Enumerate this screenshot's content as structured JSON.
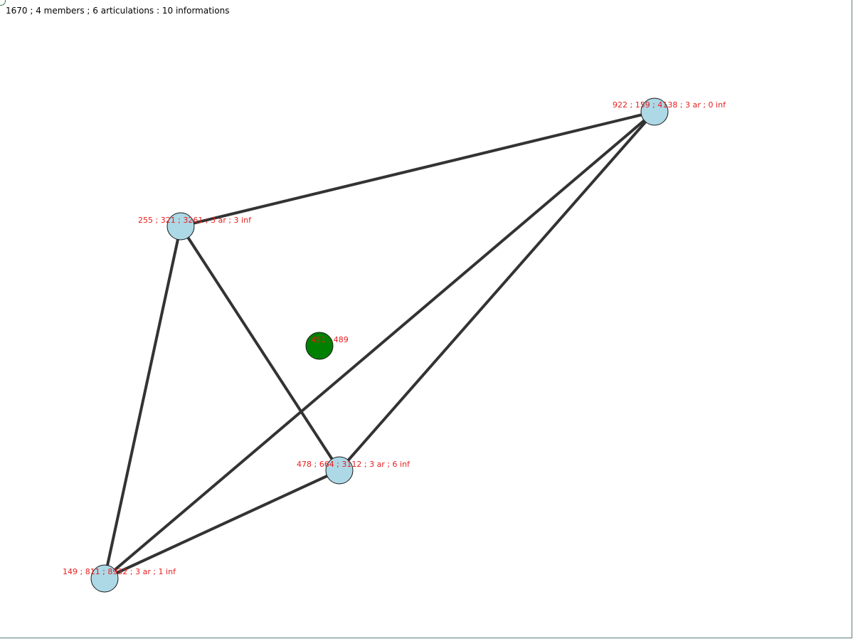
{
  "status": {
    "summary": "1670 ; 4 members ; 6 articulations : 10 informations"
  },
  "colors": {
    "edge": "#333333",
    "member_fill": "#add8e6",
    "center_fill": "#008000",
    "label": "#e81c1c"
  },
  "graph": {
    "center": {
      "label": "451 ; 489"
    },
    "nodes": [
      {
        "id": "n922",
        "label": "922 ; 159 ; 4138 ; 3 ar ; 0 inf"
      },
      {
        "id": "n255",
        "label": "255 ; 321 ; 3261 ; 3 ar ; 3 inf"
      },
      {
        "id": "n478",
        "label": "478 ; 664 ; 3112 ; 3 ar ; 6 inf"
      },
      {
        "id": "n149",
        "label": "149 ; 811 ; 8932 ; 3 ar ; 1 inf"
      }
    ],
    "edges": [
      [
        "n922",
        "n255"
      ],
      [
        "n922",
        "n478"
      ],
      [
        "n922",
        "n149"
      ],
      [
        "n255",
        "n478"
      ],
      [
        "n255",
        "n149"
      ],
      [
        "n478",
        "n149"
      ]
    ]
  }
}
